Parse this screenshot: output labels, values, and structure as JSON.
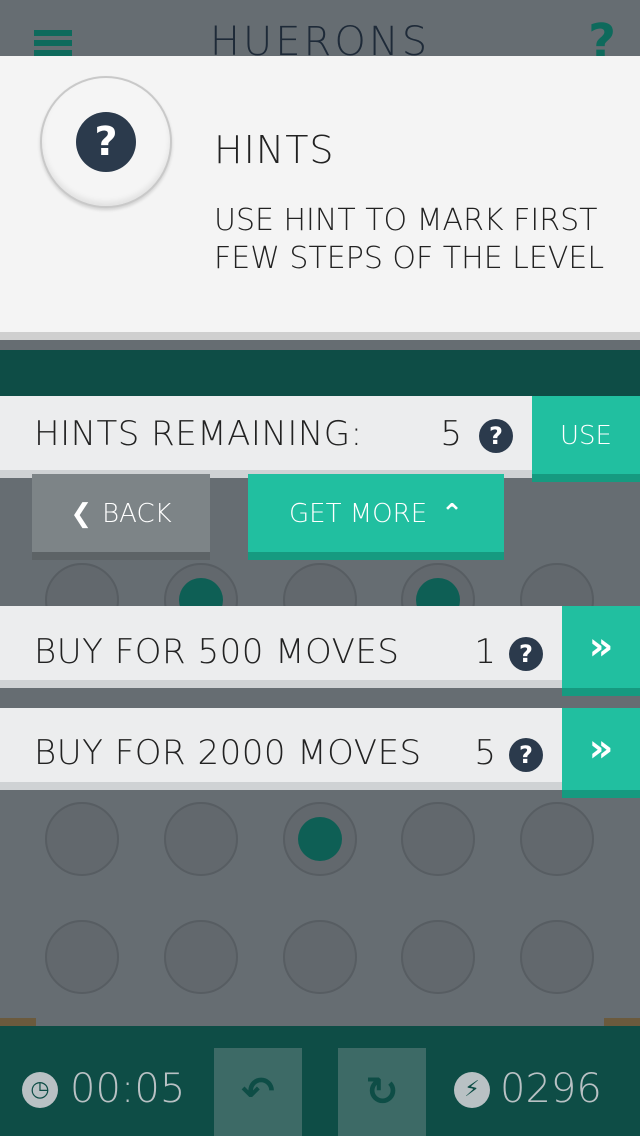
{
  "app": {
    "title": "HUERONS"
  },
  "hint_panel": {
    "title": "HINTS",
    "description": "USE HINT TO MARK FIRST FEW STEPS OF THE LEVEL",
    "badge_icon": "question-icon"
  },
  "hints_remaining": {
    "label": "HINTS REMAINING:",
    "count": "5",
    "use_label": "USE"
  },
  "actions": {
    "back_label": "BACK",
    "get_more_label": "GET MORE"
  },
  "purchase_options": [
    {
      "label": "BUY FOR 500 MOVES",
      "count": "1"
    },
    {
      "label": "BUY FOR 2000 MOVES",
      "count": "5"
    }
  ],
  "bottom_bar": {
    "time": "00:05",
    "moves": "0296"
  },
  "colors": {
    "accent": "#21bfa0",
    "dark_teal": "#0e4d46",
    "board": "#666d72",
    "panel": "#f4f4f4"
  }
}
